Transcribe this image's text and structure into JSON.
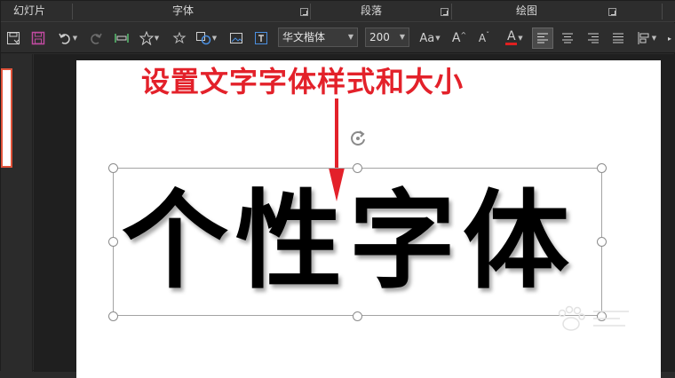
{
  "ribbon": {
    "groups": [
      {
        "label": "幻灯片"
      },
      {
        "label": "字体"
      },
      {
        "label": "段落"
      },
      {
        "label": "绘图"
      }
    ],
    "font_name": "华文楷体",
    "font_size": "200",
    "case_label": "Aa",
    "grow_label": "A",
    "shrink_label": "A",
    "color_label": "A",
    "font_color": "#e02020",
    "accent": "#b0308c"
  },
  "slide": {
    "annotation": "设置文字字体样式和大小",
    "main_text": "个性字体",
    "annotation_color": "#e3212a"
  }
}
